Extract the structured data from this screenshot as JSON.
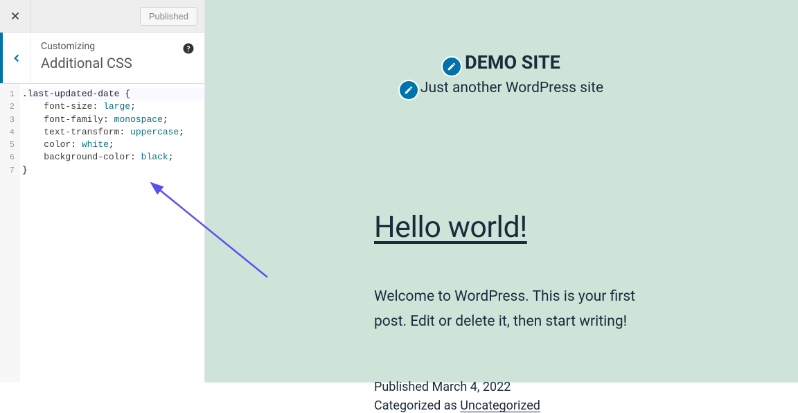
{
  "topbar": {
    "published_label": "Published"
  },
  "header": {
    "label": "Customizing",
    "title": "Additional CSS"
  },
  "code": {
    "lines": [
      {
        "n": "1",
        "html": "<span class='tok-sel'>.last-updated-date</span> <span class='tok-punct'>{</span>"
      },
      {
        "n": "2",
        "html": "    <span class='tok-prop'>font-size</span><span class='tok-punct'>:</span> <span class='tok-val'>large</span><span class='tok-punct'>;</span>"
      },
      {
        "n": "3",
        "html": "    <span class='tok-prop'>font-family</span><span class='tok-punct'>:</span> <span class='tok-val'>monospace</span><span class='tok-punct'>;</span>"
      },
      {
        "n": "4",
        "html": "    <span class='tok-prop'>text-transform</span><span class='tok-punct'>:</span> <span class='tok-val'>uppercase</span><span class='tok-punct'>;</span>"
      },
      {
        "n": "5",
        "html": "    <span class='tok-prop'>color</span><span class='tok-punct'>:</span> <span class='tok-val'>white</span><span class='tok-punct'>;</span>"
      },
      {
        "n": "6",
        "html": "    <span class='tok-prop'>background-color</span><span class='tok-punct'>:</span> <span class='tok-val'>black</span><span class='tok-punct'>;</span>"
      },
      {
        "n": "7",
        "html": "<span class='tok-punct'>}</span>"
      }
    ]
  },
  "preview": {
    "site_title": "DEMO SITE",
    "tagline": "Just another WordPress site",
    "post": {
      "title": "Hello world!",
      "body": "Welcome to WordPress. This is your first post. Edit or delete it, then start writing!",
      "published_label": "Published ",
      "published_date": "March 4, 2022",
      "categorized_label": "Categorized as ",
      "category": "Uncategorized"
    }
  }
}
